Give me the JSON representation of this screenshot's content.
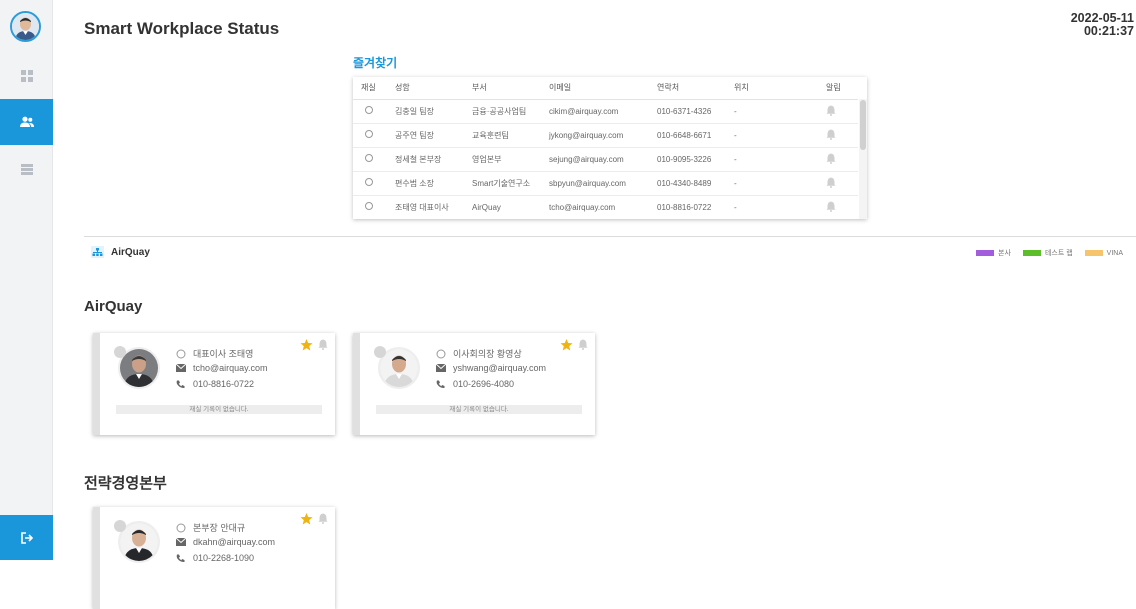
{
  "header": {
    "title": "Smart Workplace Status",
    "date": "2022-05-11",
    "time": "00:21:37"
  },
  "sidebar": {
    "items": [
      {
        "icon": "dashboard-icon",
        "active": false
      },
      {
        "icon": "people-icon",
        "active": true
      },
      {
        "icon": "list-icon",
        "active": false
      }
    ],
    "logout_icon": "logout-icon",
    "accent": "#1a96db"
  },
  "favorites": {
    "title": "즐겨찾기",
    "columns": [
      "재실",
      "성함",
      "부서",
      "이메일",
      "연락처",
      "위치",
      "알림"
    ],
    "rows": [
      {
        "name": "김충일 팀장",
        "dept": "금융·공공사업팀",
        "email": "cikim@airquay.com",
        "phone": "010-6371-4326",
        "location": "-"
      },
      {
        "name": "공주연 팀장",
        "dept": "교육훈련팀",
        "email": "jykong@airquay.com",
        "phone": "010-6648-6671",
        "location": "-"
      },
      {
        "name": "정세철 본부장",
        "dept": "영업본부",
        "email": "sejung@airquay.com",
        "phone": "010-9095-3226",
        "location": "-"
      },
      {
        "name": "편수범 소장",
        "dept": "Smart기술연구소",
        "email": "sbpyun@airquay.com",
        "phone": "010-4340-8489",
        "location": "-"
      },
      {
        "name": "조태영 대표이사",
        "dept": "AirQuay",
        "email": "tcho@airquay.com",
        "phone": "010-8816-0722",
        "location": "-"
      }
    ]
  },
  "org": {
    "label": "AirQuay",
    "legend": [
      {
        "label": "본사",
        "color": "#a25ddc"
      },
      {
        "label": "테스트 랩",
        "color": "#5cbf2a"
      },
      {
        "label": "VINA",
        "color": "#f6c46a"
      }
    ]
  },
  "sections": [
    {
      "title": "AirQuay",
      "cards": [
        {
          "name": "대표이사 조태영",
          "email": "tcho@airquay.com",
          "phone": "010-8816-0722",
          "note": "재실 기록이 없습니다.",
          "starred": true
        },
        {
          "name": "이사회의장 황영상",
          "email": "yshwang@airquay.com",
          "phone": "010-2696-4080",
          "note": "재실 기록이 없습니다.",
          "starred": true
        }
      ]
    },
    {
      "title": "전략경영본부",
      "cards": [
        {
          "name": "본부장 안대규",
          "email": "dkahn@airquay.com",
          "phone": "010-2268-1090",
          "starred": true
        }
      ]
    }
  ]
}
